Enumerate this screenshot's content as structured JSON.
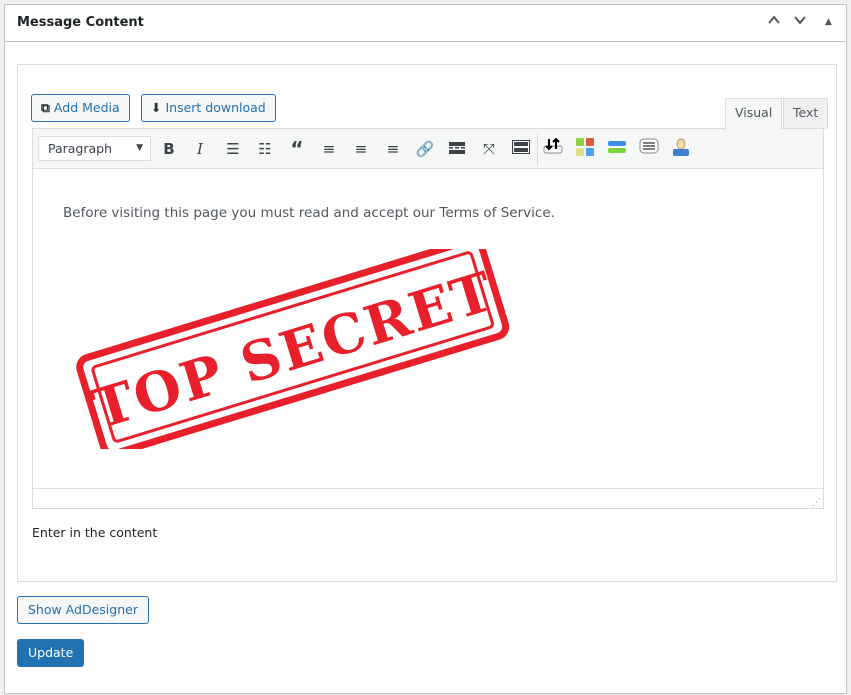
{
  "panel": {
    "title": "Message Content",
    "move_up": "⌃",
    "move_down": "⌄",
    "toggle": "▲"
  },
  "media_buttons": {
    "add_media": "Add Media",
    "insert_download": "Insert download"
  },
  "tabs": {
    "visual": "Visual",
    "text": "Text",
    "active": "Visual"
  },
  "toolbar": {
    "format_select": "Paragraph",
    "icons": [
      "bold-icon",
      "italic-icon",
      "bullet-list-icon",
      "numbered-list-icon",
      "blockquote-icon",
      "align-left-icon",
      "align-center-icon",
      "align-right-icon",
      "link-icon",
      "read-more-icon",
      "fullscreen-icon",
      "toolbar-toggle-icon",
      "sort-icon",
      "grid-icon",
      "bars-icon",
      "text-box-icon",
      "user-icon"
    ]
  },
  "editor": {
    "text": "Before visiting this page you must read and accept our Terms of Service.",
    "stamp_text": "TOP SECRET",
    "stamp_color": "#e8202b"
  },
  "help_text": "Enter in the content",
  "buttons": {
    "show_addesigner": "Show AdDesigner",
    "update": "Update"
  },
  "colors": {
    "accent": "#2271b1"
  }
}
